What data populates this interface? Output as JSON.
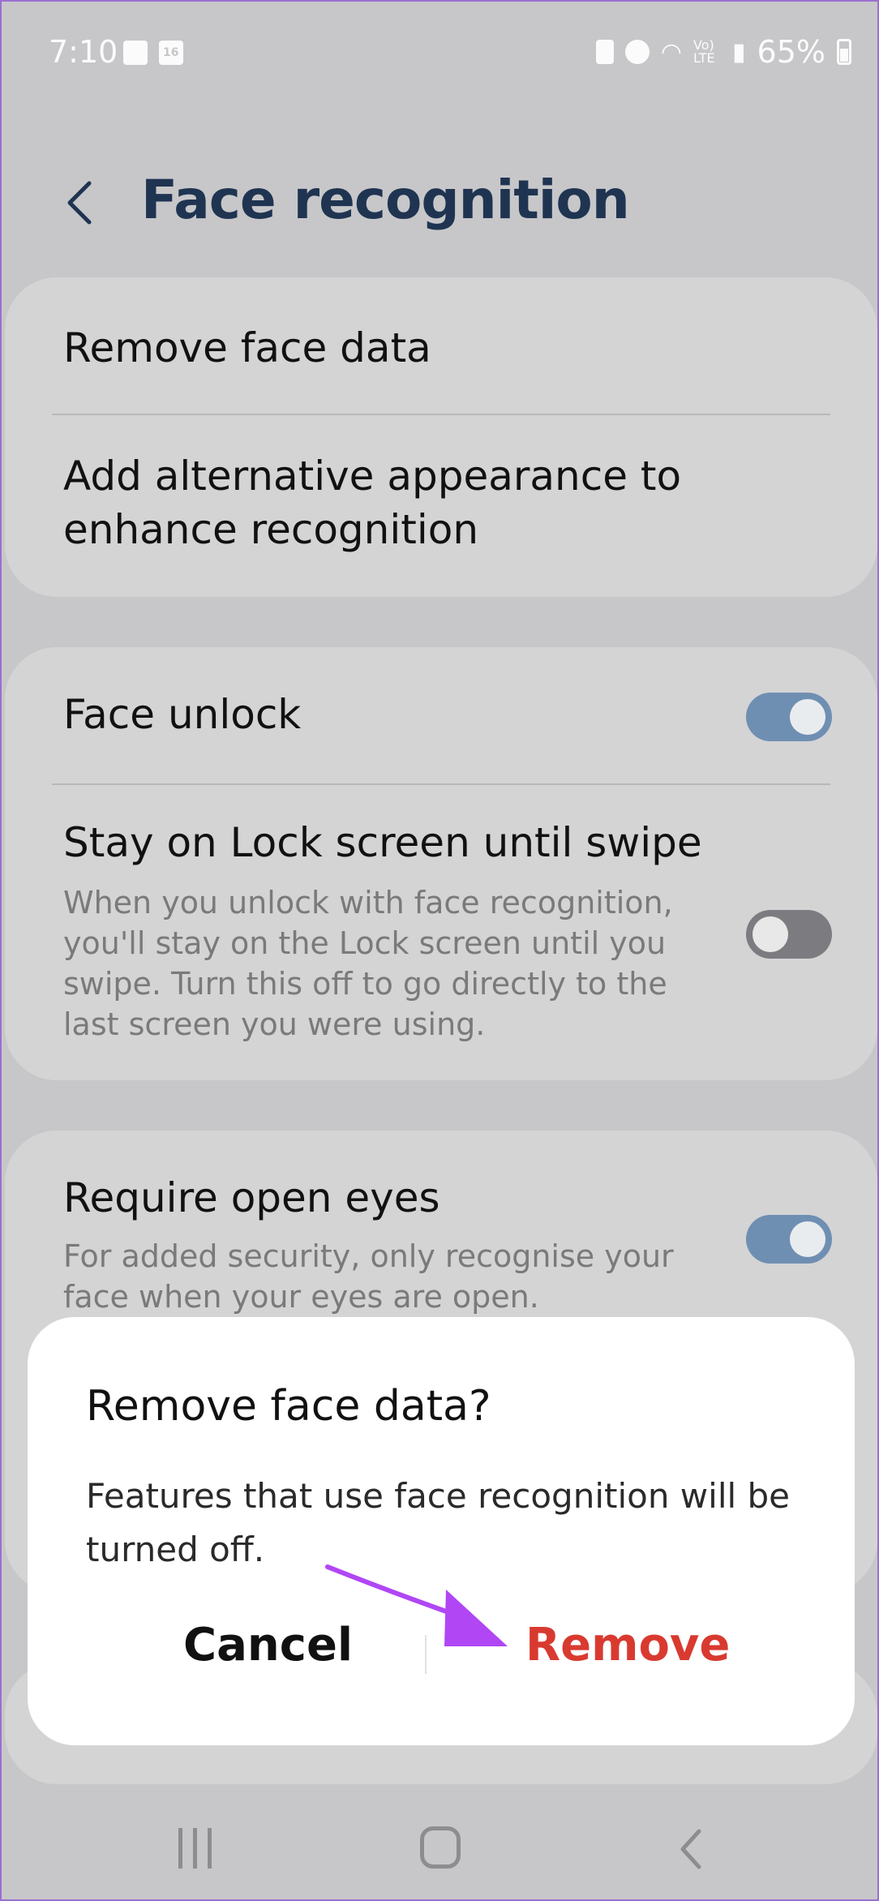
{
  "status_bar": {
    "time": "7:10",
    "network": "Vo) LTE",
    "battery": "65%"
  },
  "header": {
    "title": "Face recognition"
  },
  "card1": {
    "remove_face_data": "Remove face data",
    "alt_appearance": "Add alternative appearance to enhance recognition"
  },
  "card2": {
    "face_unlock": {
      "title": "Face unlock",
      "enabled": true
    },
    "stay_on_lock": {
      "title": "Stay on Lock screen until swipe",
      "description": "When you unlock with face recognition, you'll stay on the Lock screen until you swipe. Turn this off to go directly to the last screen you were using.",
      "enabled": false
    }
  },
  "card3": {
    "require_open_eyes": {
      "title": "Require open eyes",
      "description": "For added security, only recognise your face when your eyes are open.",
      "enabled": true
    }
  },
  "dialog": {
    "title": "Remove face data?",
    "body": "Features that use face recognition will be turned off.",
    "cancel_label": "Cancel",
    "remove_label": "Remove"
  },
  "colors": {
    "background": "#c7c7c9",
    "card": "#d4d4d5",
    "title": "#1f3451",
    "toggle_on": "#6f8fb2",
    "toggle_off": "#7c7c80",
    "remove": "#d93a30",
    "arrow": "#b146f5"
  }
}
